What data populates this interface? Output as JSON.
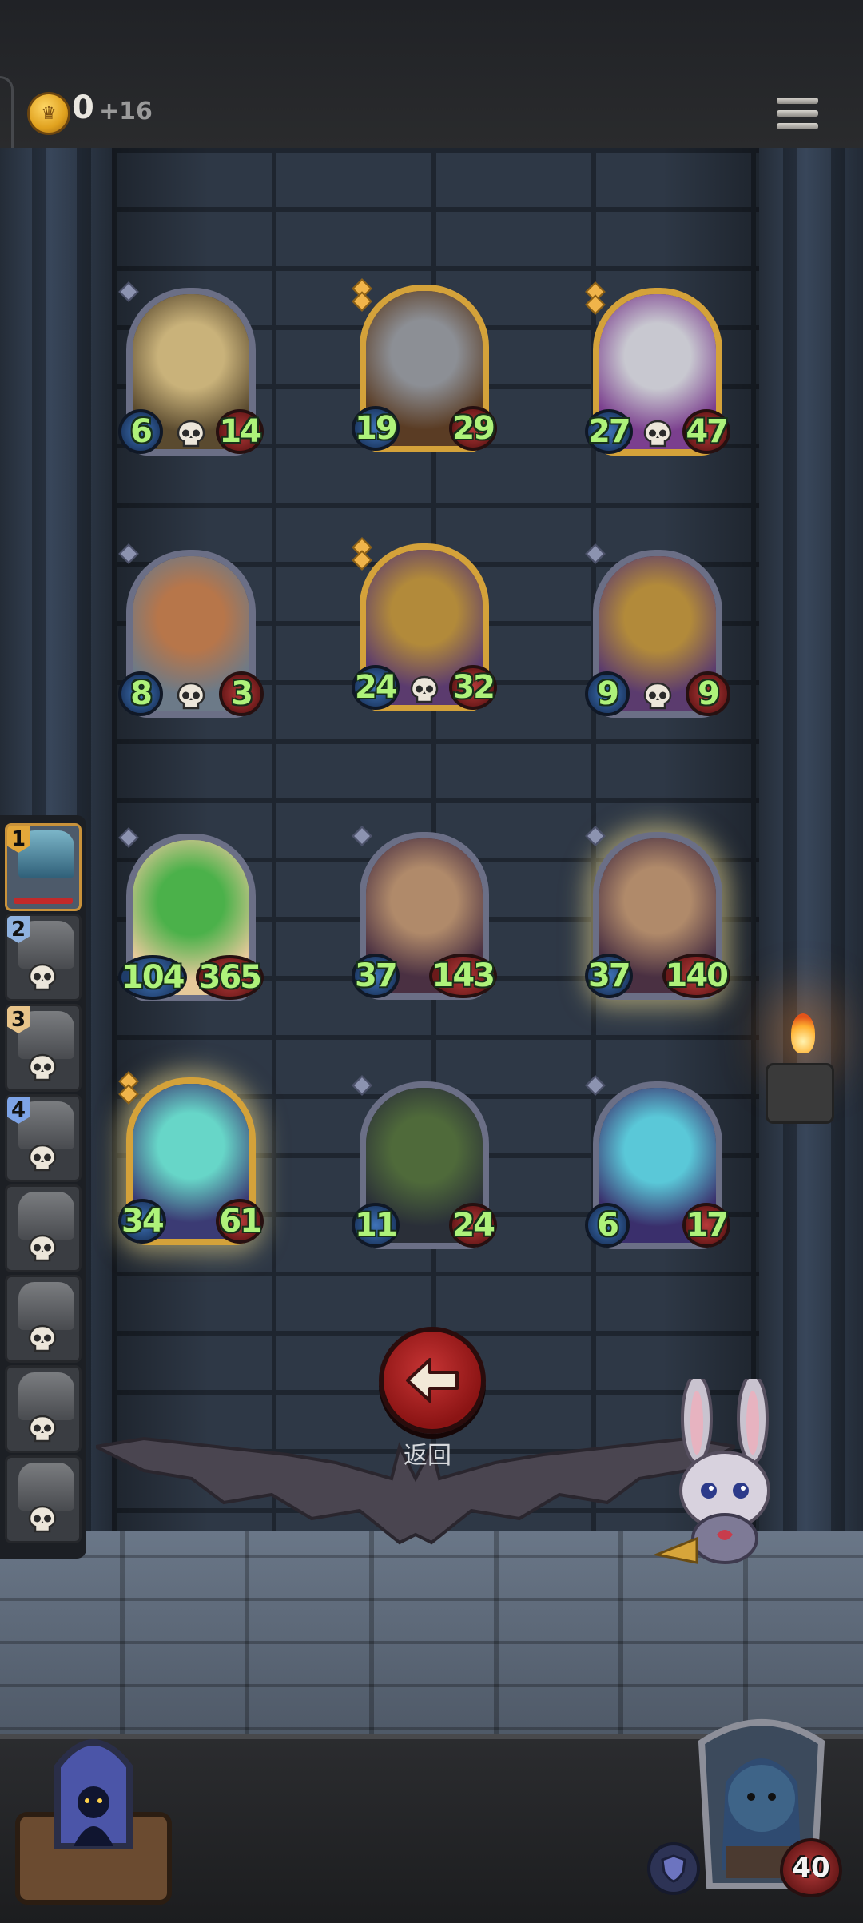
{
  "top_bar": {
    "gold": "0",
    "gold_income": "+16",
    "menu_icon": "hamburger-menu-icon"
  },
  "cards": [
    {
      "id": "clock-bot",
      "attack": "6",
      "health": "14",
      "rarity": "bronze",
      "skull": true,
      "art": "clock-icon"
    },
    {
      "id": "armored-knight",
      "attack": "19",
      "health": "29",
      "rarity": "gold",
      "skull": false,
      "art": "knight-icon"
    },
    {
      "id": "steam-cannon",
      "attack": "27",
      "health": "47",
      "rarity": "gold",
      "skull": true,
      "art": "cannon-icon"
    },
    {
      "id": "airship",
      "attack": "8",
      "health": "3",
      "rarity": "bronze",
      "skull": true,
      "art": "airship-icon"
    },
    {
      "id": "steam-tank-gold",
      "attack": "24",
      "health": "32",
      "rarity": "gold",
      "skull": true,
      "art": "tank-icon"
    },
    {
      "id": "steam-tank",
      "attack": "9",
      "health": "9",
      "rarity": "bronze",
      "skull": true,
      "art": "tank-icon"
    },
    {
      "id": "leaf-sprout",
      "attack": "104",
      "health": "365",
      "rarity": "bronze",
      "skull": false,
      "art": "leaf-icon"
    },
    {
      "id": "brute-purple",
      "attack": "37",
      "health": "143",
      "rarity": "bronze",
      "skull": false,
      "art": "brute-icon"
    },
    {
      "id": "brute-glow",
      "attack": "37",
      "health": "140",
      "rarity": "bronze",
      "skull": false,
      "art": "brute-icon"
    },
    {
      "id": "starfish-king",
      "attack": "34",
      "health": "61",
      "rarity": "gold",
      "skull": false,
      "art": "starfish-icon"
    },
    {
      "id": "toothy-plant",
      "attack": "11",
      "health": "24",
      "rarity": "bronze",
      "skull": false,
      "art": "monster-icon"
    },
    {
      "id": "sea-warrior",
      "attack": "6",
      "health": "17",
      "rarity": "bronze",
      "skull": false,
      "art": "warrior-icon"
    }
  ],
  "queue": [
    {
      "number": "1",
      "badge_color": "#e3a73a"
    },
    {
      "number": "2",
      "badge_color": "#8fb2e0"
    },
    {
      "number": "3",
      "badge_color": "#e8c48a"
    },
    {
      "number": "4",
      "badge_color": "#7da3e6"
    },
    {
      "number": "",
      "badge_color": ""
    },
    {
      "number": "",
      "badge_color": ""
    },
    {
      "number": "",
      "badge_color": ""
    },
    {
      "number": "",
      "badge_color": ""
    }
  ],
  "back": {
    "label": "返回",
    "icon": "arrow-left-icon"
  },
  "hero": {
    "health": "40",
    "shield_icon": "shield-icon"
  },
  "colors": {
    "attack_text": "#aef27a",
    "back_button": "#b22222",
    "gold_frame": "#d4a23a"
  }
}
